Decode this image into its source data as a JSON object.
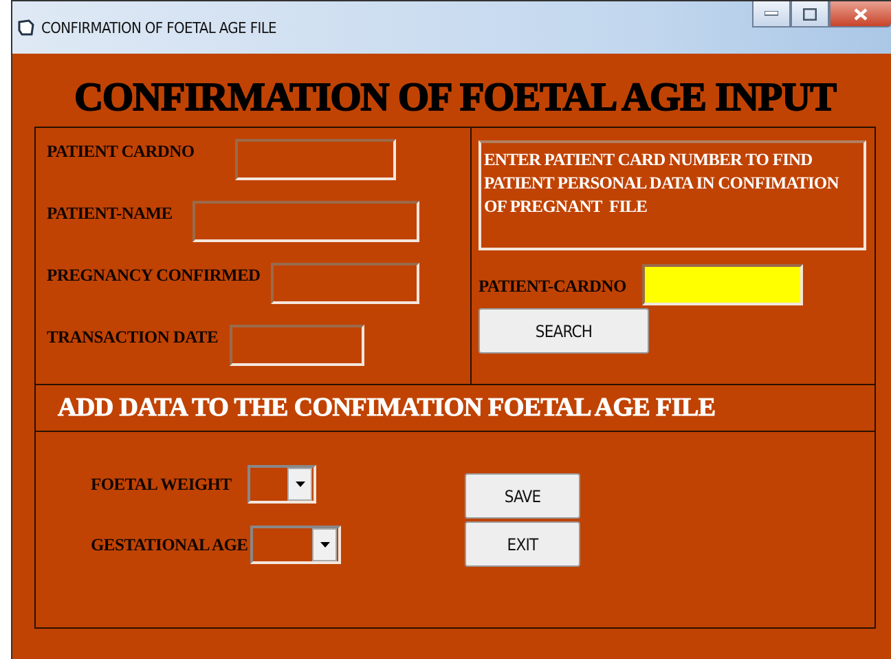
{
  "window": {
    "title": "CONFIRMATION OF FOETAL AGE FILE"
  },
  "heading": "CONFIRMATION OF FOETAL AGE INPUT",
  "patient_fields": [
    {
      "label": "PATIENT CARDNO"
    },
    {
      "label": "PATIENT-NAME"
    },
    {
      "label": "PREGNANCY CONFIRMED"
    },
    {
      "label": "TRANSACTION DATE"
    }
  ],
  "search_panel": {
    "instructions": "ENTER PATIENT CARD NUMBER TO FIND PATIENT PERSONAL DATA IN CONFIMATION OF PREGNANT  FILE",
    "cardno_label": "PATIENT-CARDNO",
    "search_button": "SEARCH"
  },
  "add_section": {
    "heading": "ADD DATA TO THE CONFIMATION FOETAL AGE FILE",
    "dropdowns": [
      {
        "label": "FOETAL WEIGHT"
      },
      {
        "label": "GESTATIONAL AGE"
      }
    ],
    "buttons": [
      {
        "label": "SAVE"
      },
      {
        "label": "EXIT"
      }
    ]
  }
}
